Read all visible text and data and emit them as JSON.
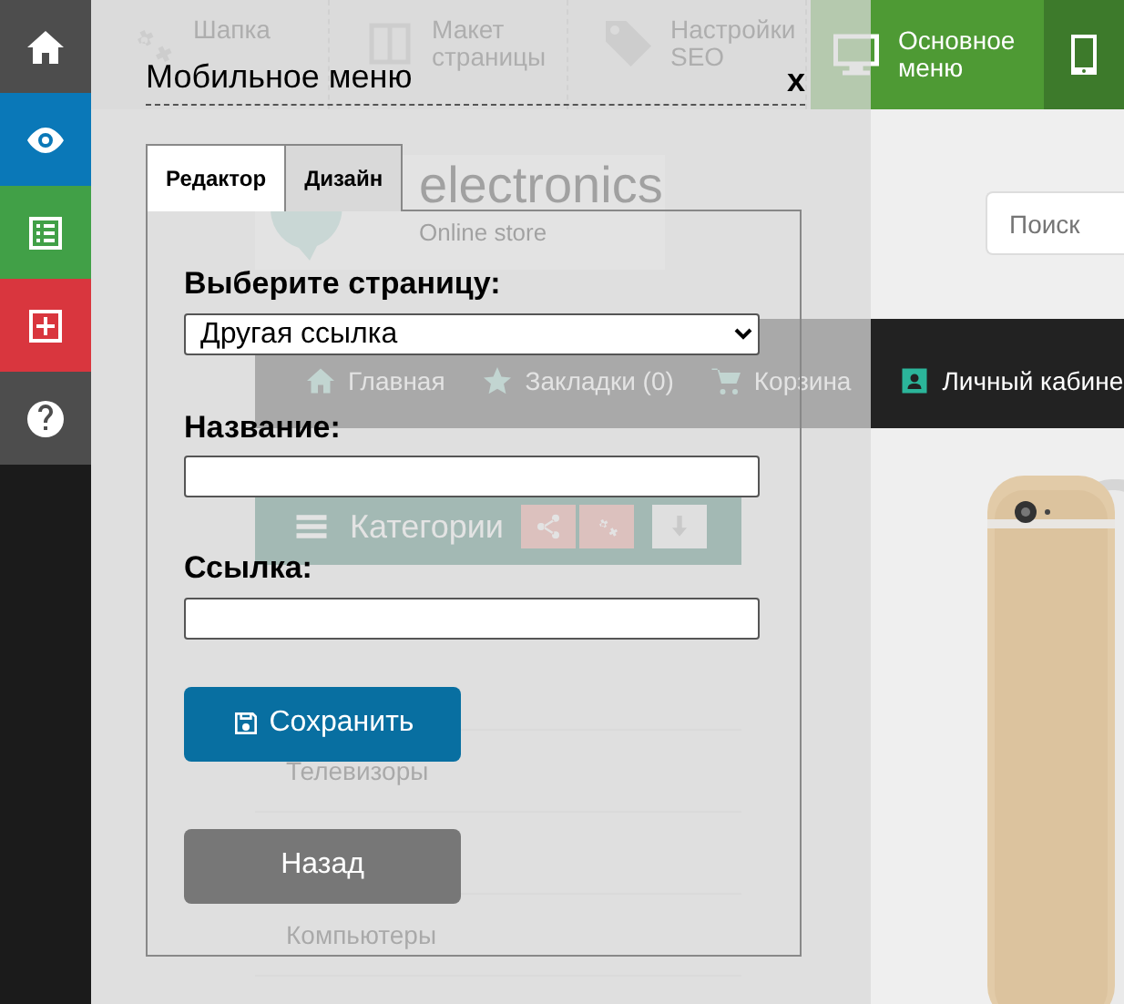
{
  "sidebar": {
    "items": [
      {
        "kind": "home",
        "color": "#4d4d4d"
      },
      {
        "kind": "eye",
        "color": "#0a78b8"
      },
      {
        "kind": "list",
        "color": "#41a047"
      },
      {
        "kind": "plus",
        "color": "#d9363e"
      },
      {
        "kind": "help",
        "color": "#4d4d4d"
      }
    ]
  },
  "toolbar": {
    "items": [
      {
        "label": "Шапка",
        "kind": "gears"
      },
      {
        "label": "Макет страницы",
        "kind": "layout"
      },
      {
        "label": "Настройки SEO",
        "kind": "tag"
      }
    ],
    "devices": [
      {
        "label": "Основное меню",
        "kind": "desktop",
        "selected": true
      },
      {
        "kind": "tablet",
        "selected": false
      }
    ]
  },
  "site": {
    "logo": {
      "name": "electronics",
      "tagline": "Online store"
    },
    "search": {
      "placeholder": "Поиск"
    },
    "nav": [
      {
        "label": "Главная",
        "kind": "home"
      },
      {
        "label": "Закладки (0)",
        "kind": "star"
      },
      {
        "label": "Корзина",
        "kind": "cart"
      },
      {
        "label": "Личный кабине",
        "kind": "user"
      }
    ],
    "categories": {
      "title": "Категории",
      "items": [
        "Телевизоры",
        "Компьютеры"
      ]
    }
  },
  "dialog": {
    "title": "Мобильное меню",
    "close": "x",
    "tabs": [
      {
        "label": "Редактор",
        "selected": true
      },
      {
        "label": "Дизайн",
        "selected": false
      }
    ],
    "page_select": {
      "label": "Выберите страницу:",
      "value": "Другая ссылка"
    },
    "name_field": {
      "label": "Название:"
    },
    "link_field": {
      "label": "Ссылка:"
    },
    "buttons": [
      {
        "label": "Сохранить",
        "kind": "save"
      },
      {
        "label": "Назад",
        "kind": "back"
      }
    ]
  }
}
